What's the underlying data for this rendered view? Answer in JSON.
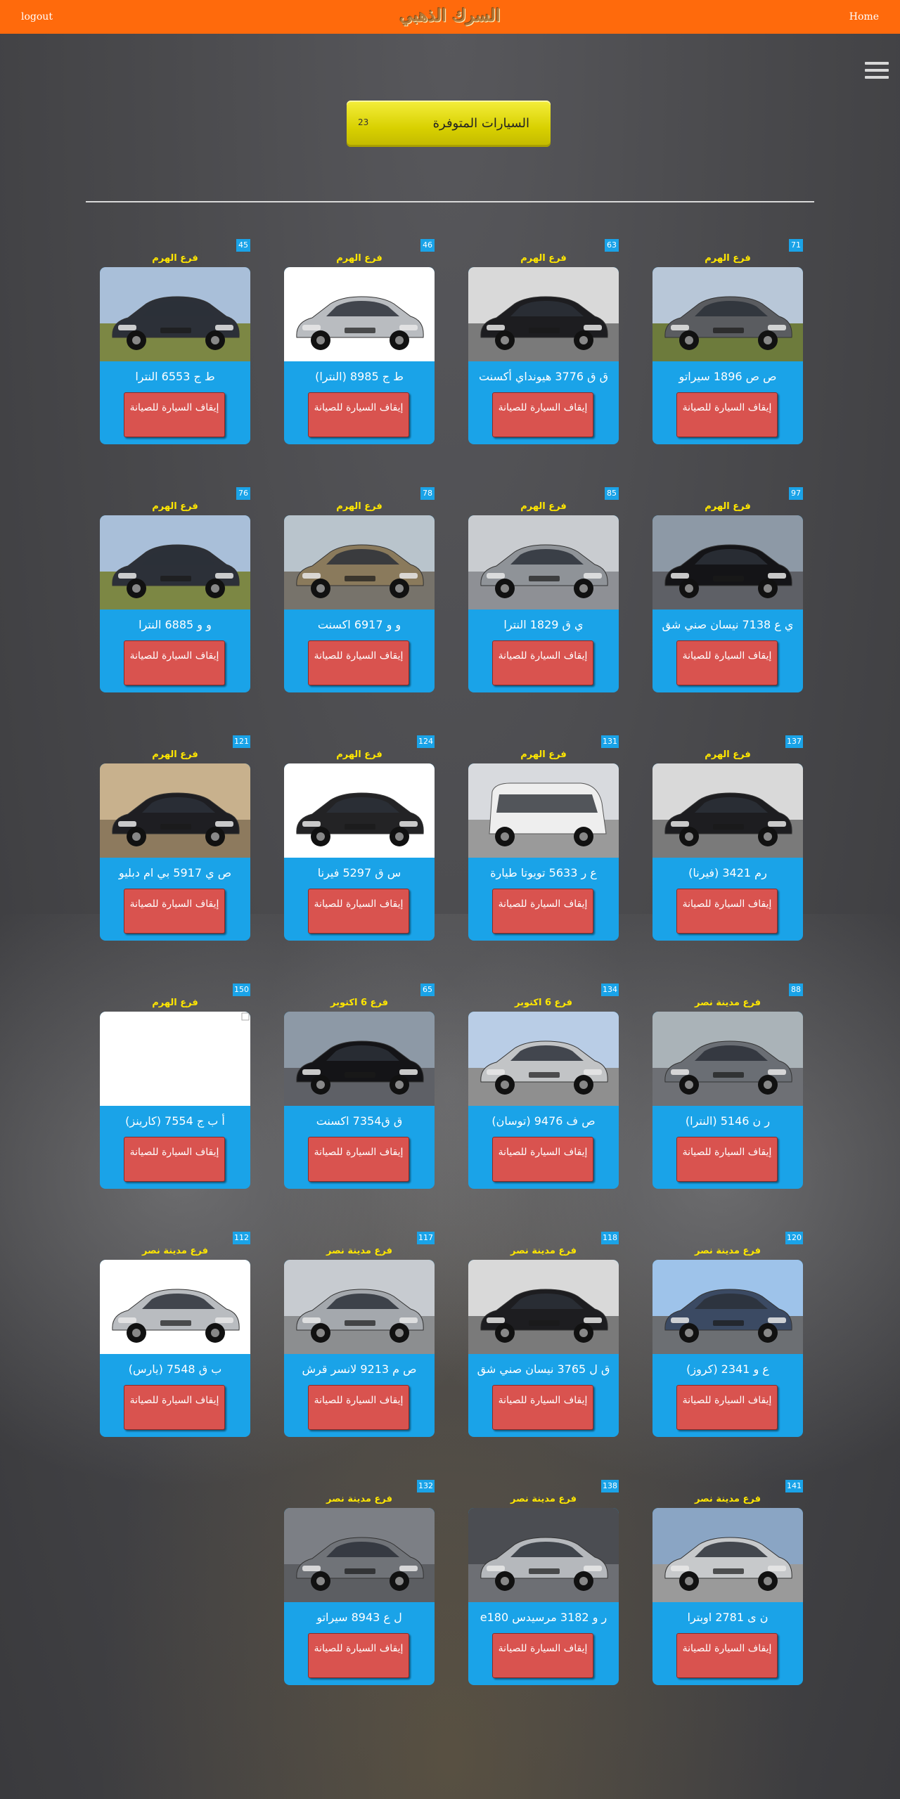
{
  "topbar": {
    "logout": "logout",
    "home": "Home",
    "logo": "السرك الذهبي"
  },
  "available": {
    "label": "السيارات المتوفرة",
    "count": "23"
  },
  "stop_label": "إيقاف السيارة للصيانة",
  "colors": {
    "topbar": "#ff6a0c",
    "card": "#1aa3e8",
    "button": "#d9534f",
    "branch_text": "#ffe600",
    "badge": "#f4ee3c"
  },
  "cars": [
    {
      "id": "71",
      "branch": "فرع الهرم",
      "plate": "ص ص 1896 سيراتو",
      "photo": "sedan-gray-field"
    },
    {
      "id": "63",
      "branch": "فرع الهرم",
      "plate": "ق ق 3776 هيونداي أكسنت",
      "photo": "sedan-black-lot"
    },
    {
      "id": "46",
      "branch": "فرع الهرم",
      "plate": "ط ج 8985 (النترا)",
      "photo": "sedan-silver-white"
    },
    {
      "id": "45",
      "branch": "فرع الهرم",
      "plate": "ط ج 6553 النترا",
      "photo": "sedan-dark-field"
    },
    {
      "id": "97",
      "branch": "فرع الهرم",
      "plate": "ي ع 7138 نيسان صني شق",
      "photo": "sedan-black-street"
    },
    {
      "id": "85",
      "branch": "فرع الهرم",
      "plate": "ي ق 1829 النترا",
      "photo": "sedan-silver-lot"
    },
    {
      "id": "78",
      "branch": "فرع الهرم",
      "plate": "و و 6917 اكسنت",
      "photo": "sedan-bronze-lot"
    },
    {
      "id": "76",
      "branch": "فرع الهرم",
      "plate": "و و 6885 النترا",
      "photo": "sedan-dark-field"
    },
    {
      "id": "137",
      "branch": "فرع الهرم",
      "plate": "رم 3421 (فيرنا)",
      "photo": "sedan-black-lot"
    },
    {
      "id": "131",
      "branch": "فرع الهرم",
      "plate": "ع ر 5633 تويوتا طيارة",
      "photo": "van-white"
    },
    {
      "id": "124",
      "branch": "فرع الهرم",
      "plate": "س ق 5297 فيرنا",
      "photo": "sedan-black-white"
    },
    {
      "id": "121",
      "branch": "فرع الهرم",
      "plate": "ص ي 5917 بي ام دبليو",
      "photo": "sedan-black-building"
    },
    {
      "id": "88",
      "branch": "فرع مدينة نصر",
      "plate": "ر ن 5146 (النترا)",
      "photo": "sedan-gray-street"
    },
    {
      "id": "134",
      "branch": "فرع 6 اكتوبر",
      "plate": "ص ف 9476 (توسان)",
      "photo": "suv-silver"
    },
    {
      "id": "65",
      "branch": "فرع 6 اكتوبر",
      "plate": "ق ق7354 اكسنت",
      "photo": "sedan-black-street"
    },
    {
      "id": "150",
      "branch": "فرع الهرم",
      "plate": "أ ب ج 7554 (كارينز)",
      "photo": "blank"
    },
    {
      "id": "120",
      "branch": "فرع مدينة نصر",
      "plate": "ع و 2341 (كروز)",
      "photo": "sedan-blue-sky"
    },
    {
      "id": "118",
      "branch": "فرع مدينة نصر",
      "plate": "ق ل 3765 نيسان صني شق",
      "photo": "sedan-black-lot"
    },
    {
      "id": "117",
      "branch": "فرع مدينة نصر",
      "plate": "ص م 9213 لانسر قرش",
      "photo": "sedan-silver-street"
    },
    {
      "id": "112",
      "branch": "فرع مدينة نصر",
      "plate": "ب ق 7548 (يارس)",
      "photo": "sedan-silver-white"
    },
    {
      "id": "141",
      "branch": "فرع مدينة نصر",
      "plate": "ن ى 2781 اوبترا",
      "photo": "hatch-silver-building"
    },
    {
      "id": "138",
      "branch": "فرع مدينة نصر",
      "plate": "ر و 3182 مرسيدس e180",
      "photo": "sedan-silver-show"
    },
    {
      "id": "132",
      "branch": "فرع مدينة نصر",
      "plate": "ل ع 8943 سيراتو",
      "photo": "sedan-gray-show"
    }
  ]
}
